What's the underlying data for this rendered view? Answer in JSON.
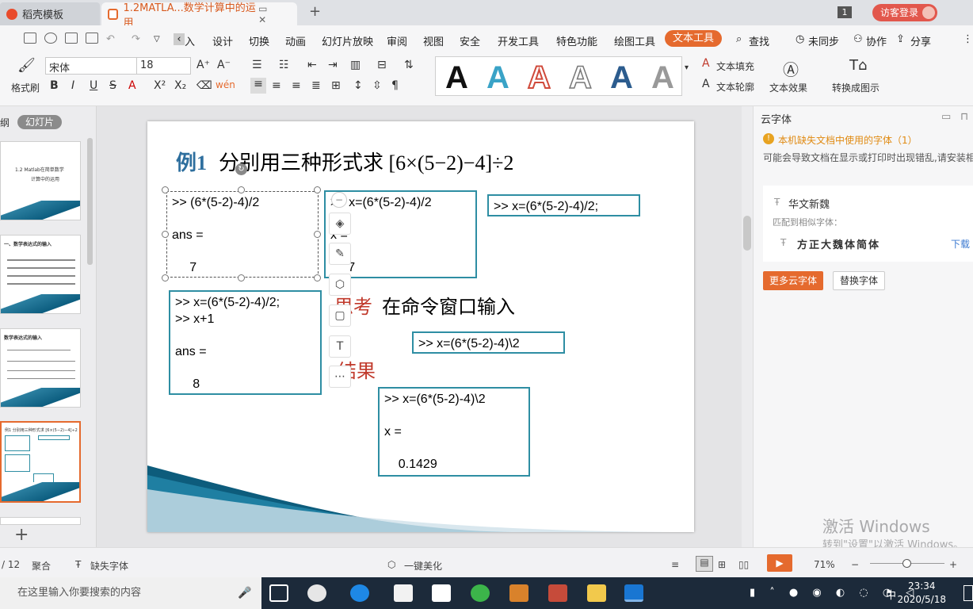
{
  "tabs": {
    "tab1": "稻壳模板",
    "tab2": "1.2MATLA...数学计算中的运用",
    "new_tab": "+",
    "page_badge": "1",
    "login": "访客登录"
  },
  "menu": {
    "items": [
      "入",
      "设计",
      "切换",
      "动画",
      "幻灯片放映",
      "审阅",
      "视图",
      "安全",
      "开发工具",
      "特色功能",
      "绘图工具"
    ],
    "active": "文本工具",
    "search": "查找",
    "sync": "未同步",
    "collab": "协作",
    "share": "分享"
  },
  "ribbon": {
    "format_painter": "格式刷",
    "font_name": "宋体",
    "font_size": "18",
    "bold": "B",
    "italic": "I",
    "underline": "U",
    "strike": "S",
    "wordart_letter": "A",
    "text_fill": "文本填充",
    "text_outline": "文本轮廓",
    "text_effect": "文本效果",
    "convert": "转换成图示"
  },
  "side": {
    "outline_tab": "纲",
    "slides_tab": "幻灯片",
    "add": "+",
    "thumb1_title": "1.2  Matlab在简单数学",
    "thumb1_sub": "计算中的运用",
    "thumb2_title": "一、数学表达式的输入",
    "thumb3_title": "数学表达式的输入",
    "thumb4_title": "例1 分别用三种形式求 [6×(5−2)−4]÷2"
  },
  "slide": {
    "title_num": "例1",
    "title_text": "分别用三种形式求 [6×(5−2)−4]÷2",
    "box1": ">> (6*(5-2)-4)/2\n\nans =\n\n     7",
    "box2": ">> x=(6*(5-2)-4)/2\n\nx =\n\n     7",
    "box3": ">> x=(6*(5-2)-4)/2;",
    "box4": ">> x=(6*(5-2)-4)/2;\n>> x+1\n\nans =\n\n     8",
    "think_label": "思考",
    "think_text": "在命令窗口输入",
    "box5": ">> x=(6*(5-2)-4)\\2",
    "result_label": "结果",
    "box6": ">> x=(6*(5-2)-4)\\2\n\nx =\n\n    0.1429"
  },
  "right": {
    "header": "云字体",
    "warning": "本机缺失文档中使用的字体（1）",
    "desc": "可能会导致文档在显示或打印时出现错乱,请安装相应字体或替换为其他字体",
    "font1": "华文新魏",
    "match": "匹配到相似字体：",
    "font2": "方正大魏体简体",
    "download": "下载",
    "more": "更多云字体",
    "replace": "替换字体",
    "activate1": "激活 Windows",
    "activate2": "转到\"设置\"以激活 Windows。"
  },
  "status": {
    "slide_no": "/ 12",
    "merge": "聚合",
    "missing_font": "缺失字体",
    "beautify": "一键美化",
    "zoom": "71%"
  },
  "taskbar": {
    "search": "在这里输入你要搜索的内容",
    "time": "23:34",
    "date": "2020/5/18",
    "ime": "中"
  },
  "colors": {
    "accent": "#e56a2e",
    "slide_border": "#2e8ea3",
    "title_blue": "#2e6f9e",
    "red_text": "#c0392b"
  }
}
